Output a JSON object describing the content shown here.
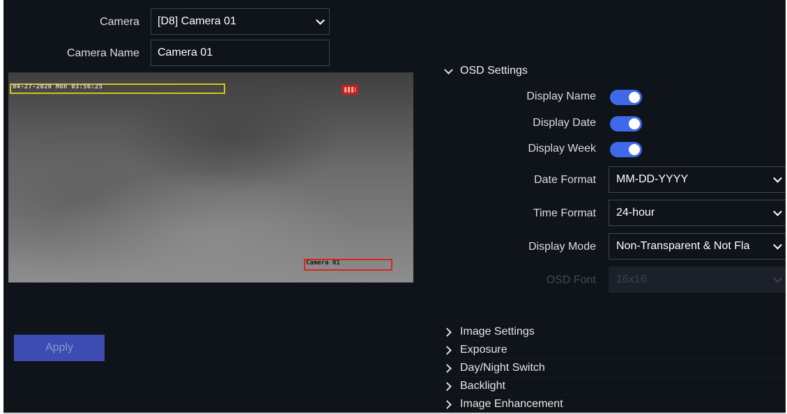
{
  "camera_form": {
    "camera_label": "Camera",
    "camera_value": "[D8] Camera 01",
    "camera_name_label": "Camera Name",
    "camera_name_value": "Camera 01"
  },
  "preview": {
    "osd_datetime": "04-27-2020 Mon 03:56:25",
    "osd_camera_name": "Camera 01"
  },
  "apply_label": "Apply",
  "osd_settings": {
    "title": "OSD Settings",
    "display_name_label": "Display Name",
    "display_name_on": true,
    "display_date_label": "Display Date",
    "display_date_on": true,
    "display_week_label": "Display Week",
    "display_week_on": true,
    "date_format_label": "Date Format",
    "date_format_value": "MM-DD-YYYY",
    "time_format_label": "Time Format",
    "time_format_value": "24-hour",
    "display_mode_label": "Display Mode",
    "display_mode_value": "Non-Transparent & Not Fla",
    "osd_font_label": "OSD Font",
    "osd_font_value": "16x16"
  },
  "sections": [
    {
      "label": "Image Settings"
    },
    {
      "label": "Exposure"
    },
    {
      "label": "Day/Night Switch"
    },
    {
      "label": "Backlight"
    },
    {
      "label": "Image Enhancement"
    }
  ],
  "colors": {
    "background": "#0f131a",
    "toggle_on": "#3f69ea",
    "apply_button": "#3d4cb3",
    "osd_date_box": "#d6c419",
    "osd_name_box": "#d9261c"
  }
}
